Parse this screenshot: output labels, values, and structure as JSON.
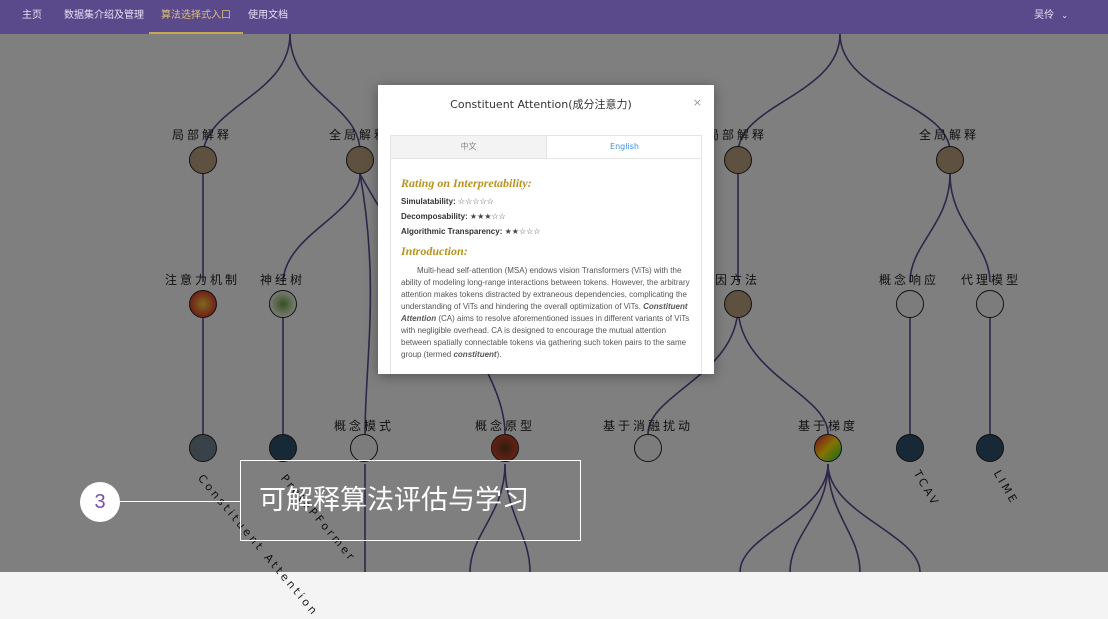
{
  "nav": {
    "items": [
      "主页",
      "数据集介绍及管理",
      "算法选择式入口",
      "使用文档"
    ],
    "active_index": 2,
    "user": "吴伶",
    "user_icon": "chevron-down-icon"
  },
  "tree": {
    "level1": [
      "局部解释",
      "全局解释",
      "局部解释",
      "全局解释"
    ],
    "level2": [
      "注意力机制",
      "神经树",
      "归因方法",
      "概念响应",
      "代理模型"
    ],
    "level3": [
      "概念模式",
      "概念原型",
      "基于消融扰动",
      "基于梯度"
    ],
    "rotated_labels": [
      "Constituent Attention",
      "ProtoPFormer",
      "TCAV",
      "LIME"
    ]
  },
  "modal": {
    "title": "Constituent Attention(成分注意力)",
    "close": "×",
    "tabs": [
      "中文",
      "English"
    ],
    "active_tab": 1,
    "rating_heading": "Rating on Interpretability:",
    "ratings": [
      {
        "label": "Simulatability:",
        "stars": "☆☆☆☆☆"
      },
      {
        "label": "Decomposability:",
        "stars": "★★★☆☆"
      },
      {
        "label": "Algorithmic Transparency:",
        "stars": "★★☆☆☆"
      }
    ],
    "intro_heading": "Introduction:",
    "intro_text_1": "Multi-head self-attention (MSA) endows vision Transformers (ViTs) with the ability of modeling long-range interactions between tokens. However, the arbitrary attention makes tokens distracted by extraneous dependencies, complicating the understanding of ViTs and hindering the overall optimization of ViTs. ",
    "intro_emph": "Constituent Attention",
    "intro_text_2": " (CA) aims to resolve aforementioned issues in different variants of ViTs with negligible overhead. CA is designed to encourage the mutual attention between spatially connectable tokens via gathering such token pairs to the same group (termed ",
    "intro_emph2": "constituent",
    "intro_text_3": ")."
  },
  "annotation": {
    "number": "3",
    "caption": "可解释算法评估与学习"
  }
}
